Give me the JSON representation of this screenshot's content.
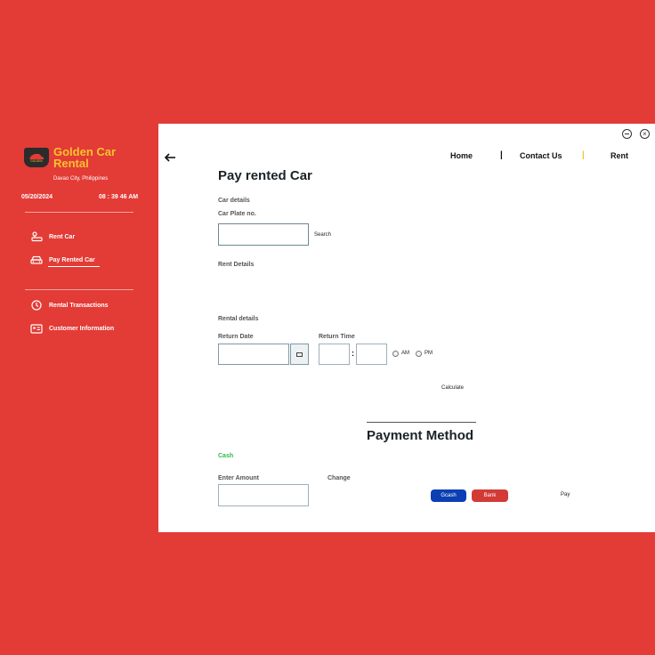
{
  "sidebar": {
    "brand_title": "Golden Car Rental",
    "badge_text": "GOLDEN",
    "location": "Davao City, Philippines",
    "date": "05/20/2024",
    "time": "08 : 39 46 AM",
    "menu": [
      {
        "label": "Rent Car",
        "icon": "car-key-icon"
      },
      {
        "label": "Pay Rented Car",
        "icon": "car-icon",
        "active": true
      }
    ],
    "menu2": [
      {
        "label": "Rental Transactions",
        "icon": "clock-icon"
      },
      {
        "label": "Customer Information",
        "icon": "id-card-icon"
      }
    ]
  },
  "topnav": {
    "home": "Home",
    "contact": "Contact Us",
    "rent": "Rent",
    "separator": "|"
  },
  "main": {
    "title": "Pay rented Car",
    "car_details": "Car details",
    "car_plate_label": "Car Plate no.",
    "car_plate_value": "",
    "search_label": "Search",
    "rent_details": "Rent Details",
    "rental_details": "Rental details",
    "return_date_label": "Return Date",
    "return_time_label": "Return Time",
    "time_colon": ":",
    "am_label": "AM",
    "pm_label": "PM",
    "calculate_label": "Calculate",
    "payment_method_title": "Payment Method",
    "cash_label": "Cash",
    "enter_amount_label": "Enter Amount",
    "change_label": "Change",
    "gcash_label": "Gcash",
    "bank_label": "Bank",
    "pay_label": "Pay"
  },
  "colors": {
    "background": "#e33b36",
    "brand_gold": "#f6c32d",
    "cash_green": "#2fb84a",
    "gcash_blue": "#0b3fb3",
    "bank_red": "#d23a36"
  }
}
